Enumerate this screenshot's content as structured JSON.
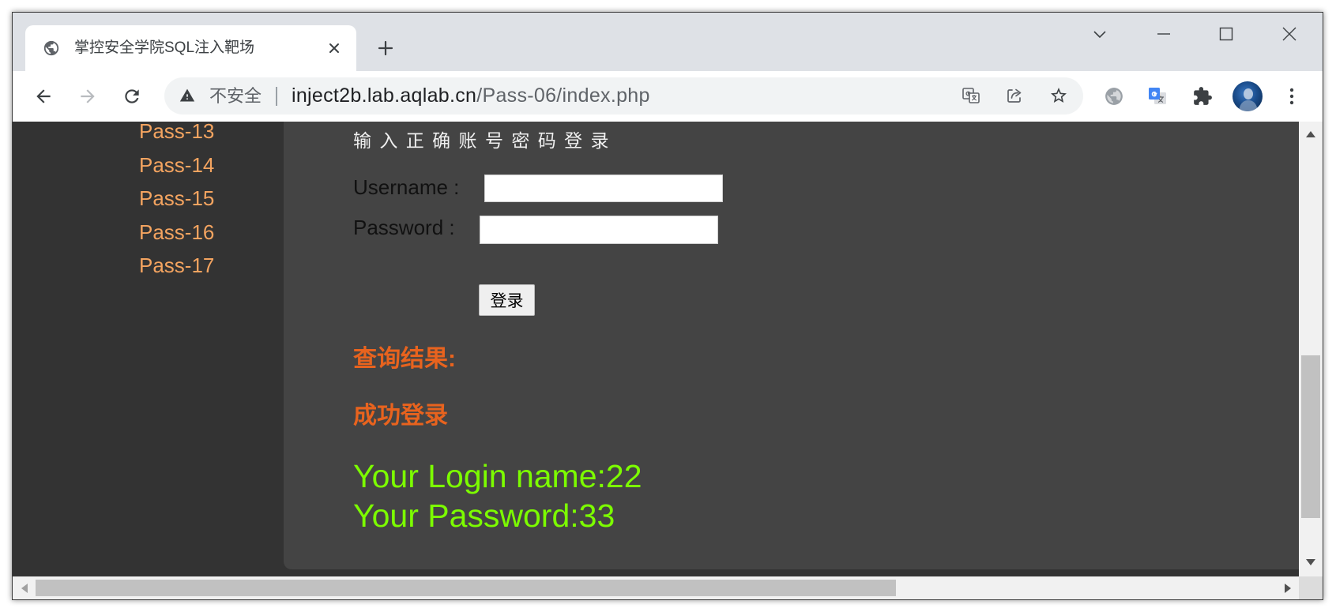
{
  "window": {
    "tab": {
      "title": "掌控安全学院SQL注入靶场",
      "favicon": "globe-icon",
      "close_icon": "close-tab-icon"
    },
    "new_tab_icon": "plus-icon",
    "controls": [
      "tab-search-chevron-icon",
      "minimize-icon",
      "maximize-icon",
      "close-window-icon"
    ]
  },
  "toolbar": {
    "nav_icons": [
      "back-arrow-icon",
      "forward-arrow-icon",
      "reload-icon"
    ],
    "omnibox": {
      "security_icon": "warning-icon",
      "security_label": "不安全",
      "url_host": "inject2b.lab.aqlab.cn",
      "url_path": "/Pass-06/index.php",
      "action_icons": [
        "translate-icon",
        "share-icon",
        "star-icon"
      ]
    },
    "extension_icons": [
      "globe-extension-icon",
      "google-translate-extension-icon",
      "puzzle-icon",
      "profile-avatar",
      "more-menu-icon"
    ]
  },
  "sidebar": {
    "links": [
      {
        "label": "Pass-13"
      },
      {
        "label": "Pass-14"
      },
      {
        "label": "Pass-15"
      },
      {
        "label": "Pass-16"
      },
      {
        "label": "Pass-17"
      }
    ]
  },
  "login_form": {
    "heading": "输 入 正 确 账 号 密 码 登 录",
    "username": {
      "label": "Username :",
      "value": ""
    },
    "password": {
      "label": "Password :",
      "value": ""
    },
    "submit_label": "登录"
  },
  "result": {
    "heading": "查询结果:",
    "status": "成功登录",
    "login_name": {
      "label": "Your Login name:",
      "value": "22"
    },
    "password": {
      "label": "Your Password:",
      "value": "33"
    }
  },
  "colors": {
    "sidebar_background": "#333333",
    "panel_background": "#444444",
    "sidebar_link": "#f4a460",
    "result_heading": "#e8631e",
    "result_values": "#7cfc00"
  }
}
